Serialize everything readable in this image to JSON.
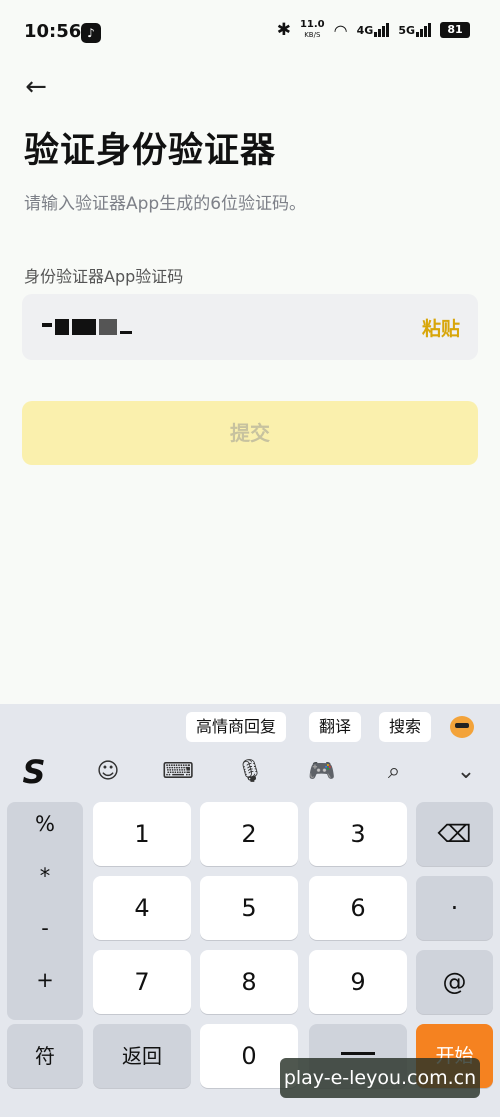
{
  "status_bar": {
    "time": "10:56",
    "tiktok_icon": "tiktok-icon",
    "speed_value": "11.0",
    "speed_unit": "KB/S",
    "net1": "4G",
    "net2": "5G",
    "battery": "81"
  },
  "header": {
    "back_icon": "arrow-left-icon",
    "title": "验证身份验证器",
    "subtitle": "请输入验证器App生成的6位验证码。"
  },
  "form": {
    "field_label": "身份验证器App验证码",
    "paste_label": "粘贴",
    "submit_label": "提交"
  },
  "keyboard": {
    "suggestions": [
      "高情商回复",
      "翻译",
      "搜索"
    ],
    "toolbar_icons": [
      "s-logo-icon",
      "emoji-icon",
      "keyboard-icon",
      "microphone-icon",
      "gamepad-icon",
      "search-icon",
      "chevron-down-icon"
    ],
    "symbols": [
      "%",
      "*",
      "-",
      "+"
    ],
    "digits": [
      "1",
      "2",
      "3",
      "4",
      "5",
      "6",
      "7",
      "8",
      "9",
      "0"
    ],
    "dot_key": "·",
    "at_key": "@",
    "fu_key": "符",
    "return_key": "返回",
    "start_key": "开始"
  },
  "watermark": "play-e-leyou.com.cn",
  "colors": {
    "accent": "#d8a60a",
    "submit_bg": "#faf0ad",
    "start_key": "#f58220"
  }
}
